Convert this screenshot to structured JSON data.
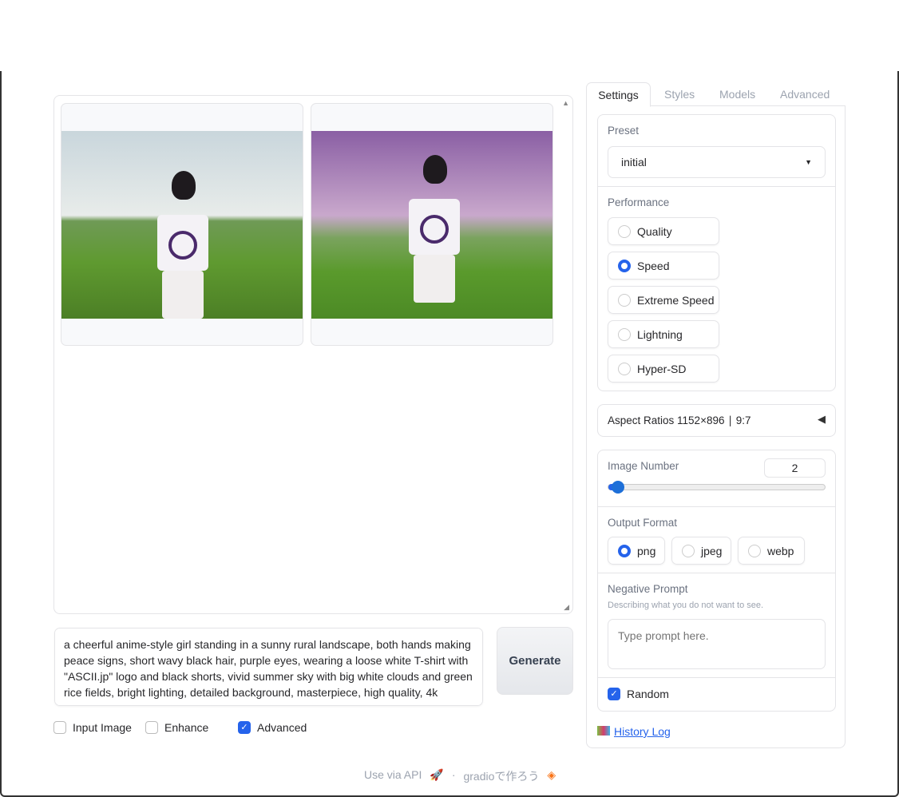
{
  "gallery": {
    "images": [
      {
        "alt": "generated image 1"
      },
      {
        "alt": "generated image 2"
      }
    ]
  },
  "prompt": {
    "value": "a cheerful anime-style girl standing in a sunny rural landscape, both hands making peace signs, short wavy black hair, purple eyes, wearing a loose white T-shirt with \"ASCII.jp\" logo and black shorts, vivid summer sky with big white clouds and green rice fields, bright lighting, detailed background, masterpiece, high quality, 4k"
  },
  "generate_label": "Generate",
  "options": [
    {
      "label": "Input Image",
      "checked": false
    },
    {
      "label": "Enhance",
      "checked": false
    },
    {
      "label": "Advanced",
      "checked": true
    }
  ],
  "tabs": [
    "Settings",
    "Styles",
    "Models",
    "Advanced"
  ],
  "preset": {
    "label": "Preset",
    "value": "initial"
  },
  "performance": {
    "label": "Performance",
    "options": [
      "Quality",
      "Speed",
      "Extreme Speed",
      "Lightning",
      "Hyper-SD"
    ],
    "selected": "Speed"
  },
  "aspect": {
    "label": "Aspect Ratios 1152×896 ∣ 9:7"
  },
  "image_number": {
    "label": "Image Number",
    "value": "2",
    "fraction": 0.03
  },
  "output_format": {
    "label": "Output Format",
    "options": [
      "png",
      "jpeg",
      "webp"
    ],
    "selected": "png"
  },
  "negative": {
    "label": "Negative Prompt",
    "info": "Describing what you do not want to see.",
    "placeholder": "Type prompt here."
  },
  "random": {
    "label": "Random",
    "checked": true
  },
  "history": "History Log",
  "footer": {
    "api": "Use via API",
    "built": "gradioで作ろう",
    "sep": "·"
  },
  "accent": "#2563eb"
}
